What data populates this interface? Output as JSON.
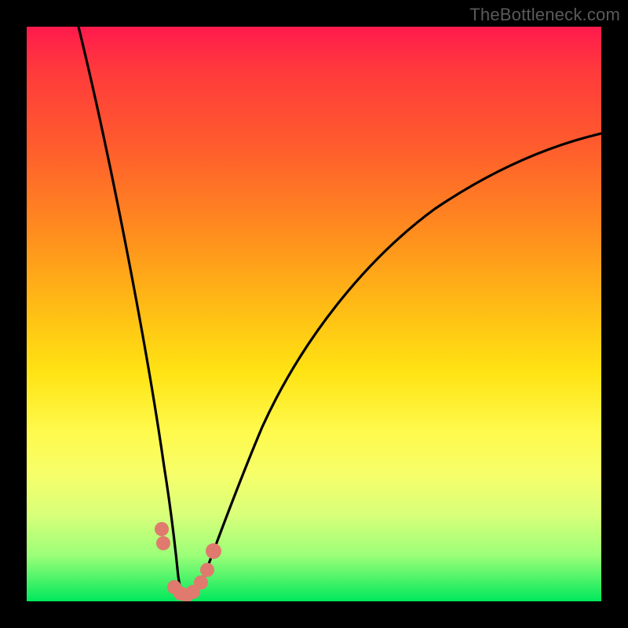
{
  "watermark": "TheBottleneck.com",
  "chart_data": {
    "type": "line",
    "title": "",
    "xlabel": "",
    "ylabel": "",
    "xlim": [
      0,
      100
    ],
    "ylim": [
      0,
      100
    ],
    "grid": false,
    "legend": false,
    "series": [
      {
        "name": "bottleneck-curve",
        "x": [
          9,
          12,
          15,
          18,
          20,
          22,
          23,
          24,
          25,
          26,
          27,
          28,
          29,
          31,
          33,
          36,
          40,
          45,
          50,
          55,
          60,
          65,
          70,
          75,
          80,
          85,
          90,
          95,
          100
        ],
        "y": [
          100,
          86,
          72,
          56,
          42,
          30,
          20,
          11,
          5,
          2,
          1,
          1,
          2,
          5,
          11,
          20,
          30,
          40,
          48,
          55,
          60,
          64,
          68,
          71,
          74,
          76,
          78,
          80,
          81
        ]
      }
    ],
    "markers": {
      "name": "highlight-points",
      "color": "#e07a6f",
      "points": [
        {
          "x": 23.0,
          "y": 12
        },
        {
          "x": 23.2,
          "y": 9
        },
        {
          "x": 25.5,
          "y": 2
        },
        {
          "x": 26.5,
          "y": 1
        },
        {
          "x": 27.5,
          "y": 1
        },
        {
          "x": 28.5,
          "y": 2
        },
        {
          "x": 30.0,
          "y": 5
        },
        {
          "x": 31.0,
          "y": 7
        },
        {
          "x": 32.0,
          "y": 10
        }
      ]
    },
    "background_gradient": {
      "top": "#ff1a4d",
      "mid": "#ffe313",
      "bottom": "#00e85c"
    }
  }
}
